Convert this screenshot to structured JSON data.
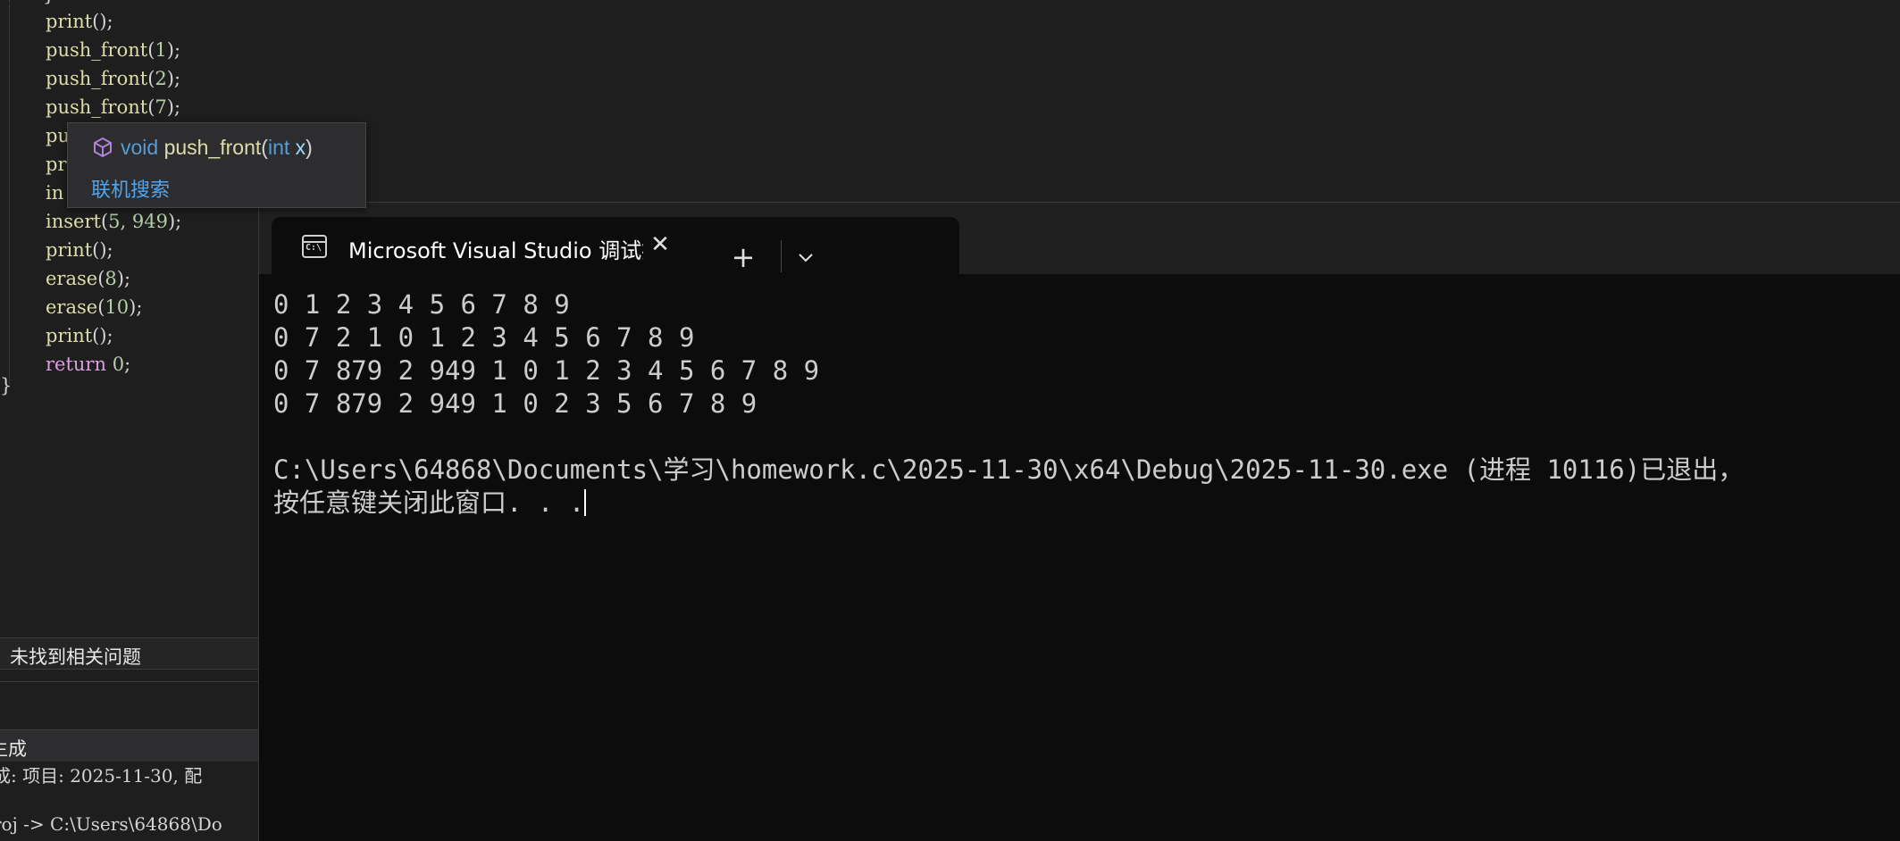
{
  "editor": {
    "closing_brace_top": "}",
    "lines": [
      {
        "fn": "print",
        "args": "",
        "end": "();"
      },
      {
        "fn": "push_front",
        "args": "1"
      },
      {
        "fn": "push_front",
        "args": "2"
      },
      {
        "fn": "push_front",
        "args": "7"
      },
      {
        "fn": "pu",
        "args": null
      },
      {
        "fn": "pr",
        "args": null
      },
      {
        "fn": "in",
        "args": null
      },
      {
        "fn": "insert",
        "args": "5, 949"
      },
      {
        "fn": "print",
        "args": ""
      },
      {
        "fn": "erase",
        "args": "8"
      },
      {
        "fn": "erase",
        "args": "10"
      },
      {
        "fn": "print",
        "args": ""
      },
      {
        "kw": "return",
        "val": "0"
      }
    ],
    "line_texts": {
      "l0": "print",
      "l1": "push_front",
      "l2": "push_front",
      "l3": "push_front",
      "l4": "pu",
      "l5": "pr",
      "l6": "in",
      "l7": "insert",
      "l8": "print",
      "l9": "erase",
      "l10": "erase",
      "l11": "print",
      "ret_kw": "return",
      "ret_val": "0",
      "a1": "1",
      "a2": "2",
      "a3": "7",
      "a7": "5, 949",
      "a9": "8",
      "a10": "10"
    },
    "closing_brace": "}"
  },
  "tooltip": {
    "void_kw": "void",
    "fn_name": "push_front",
    "param_type": "int",
    "param_name": "x",
    "icon": "cube-icon",
    "search_link": "联机搜索"
  },
  "error_list": {
    "status": "未找到相关问题"
  },
  "output_panel": {
    "title": "生成",
    "lines": [
      "成: 项目: 2025-11-30, 配",
      "roj -> C:\\Users\\64868\\Do"
    ]
  },
  "terminal": {
    "tab_title": "Microsoft Visual Studio 调试控制台",
    "tab_icon_label": "C:\\",
    "close_glyph": "✕",
    "add_glyph": "+",
    "output_lines": [
      "0 1 2 3 4 5 6 7 8 9",
      "0 7 2 1 0 1 2 3 4 5 6 7 8 9",
      "0 7 879 2 949 1 0 1 2 3 4 5 6 7 8 9",
      "0 7 879 2 949 1 0 2 3 5 6 7 8 9",
      "",
      "C:\\Users\\64868\\Documents\\学习\\homework.c\\2025-11-30\\x64\\Debug\\2025-11-30.exe (进程 10116)已退出，",
      "按任意键关闭此窗口. . ."
    ]
  },
  "colors": {
    "editor_bg": "#1e1e1e",
    "terminal_bg": "#0c0c0c",
    "function": "#dcdcaa",
    "keyword": "#d8a0df",
    "number": "#b5cea8",
    "link": "#4aa7f5"
  }
}
